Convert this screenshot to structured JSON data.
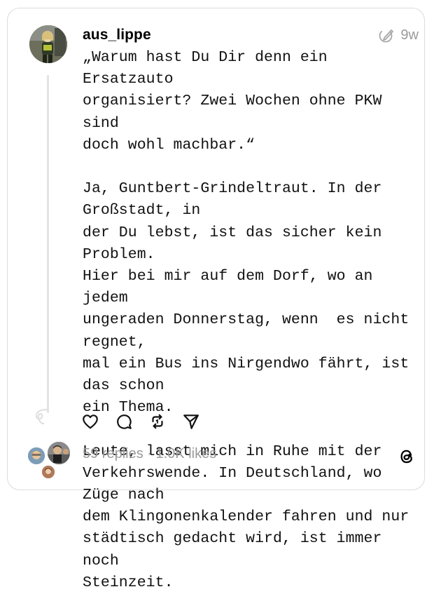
{
  "post": {
    "username": "aus_lippe",
    "time": "9w",
    "text": "„Warum hast Du Dir denn ein Ersatzauto\norganisiert? Zwei Wochen ohne PKW sind\ndoch wohl machbar.“\n\nJa, Guntbert-Grindeltraut. In der Großstadt, in\nder Du lebst, ist das sicher kein Problem.\nHier bei mir auf dem Dorf, wo an jedem\nungeraden Donnerstag, wenn  es nicht regnet,\nmal ein Bus ins Nirgendwo fährt, ist das schon\nein Thema.\n\nLeute, lasst mich in Ruhe mit der\nVerkehrswende. In Deutschland, wo Züge nach\ndem Klingonenkalender fahren und nur\nstädtisch gedacht wird, ist immer noch\nSteinzeit."
  },
  "footer": {
    "stats": "59 replies · 1.0K likes"
  },
  "icons": {
    "edited": "edited-icon",
    "like": "heart-icon",
    "comment": "comment-icon",
    "repost": "repost-icon",
    "share": "share-icon",
    "brand": "threads-logo-icon"
  },
  "colors": {
    "muted_text": "#999999",
    "border": "#dcdcdc",
    "thread_line": "#e3e3e3"
  }
}
